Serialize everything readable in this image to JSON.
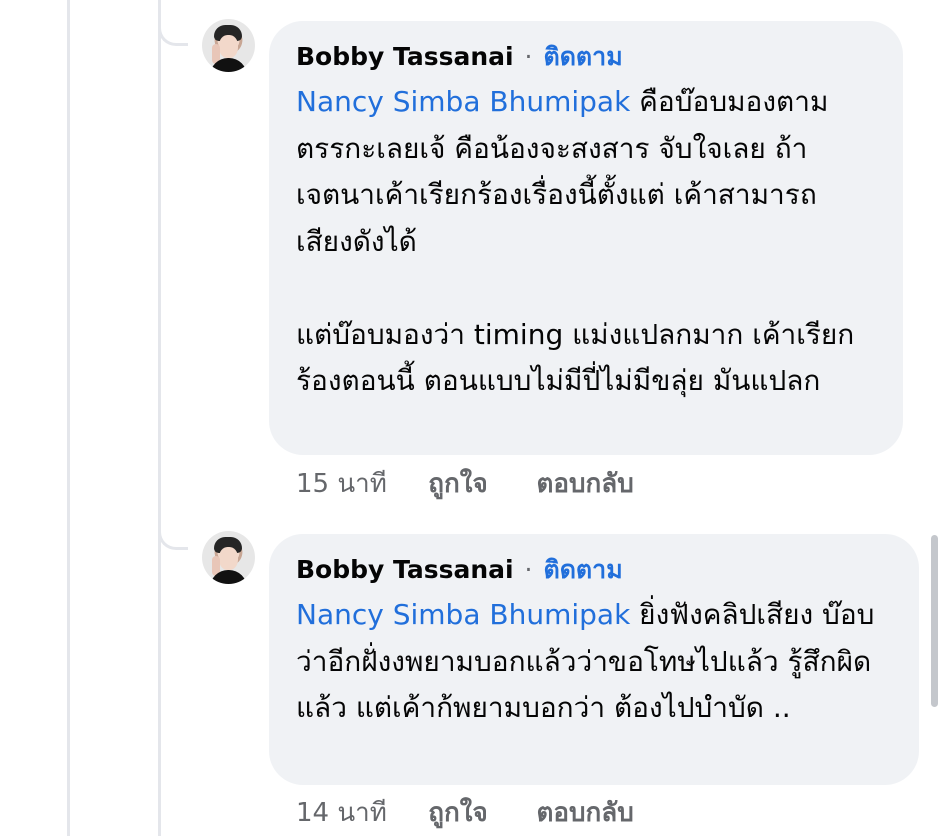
{
  "comments": [
    {
      "author": "Bobby Tassanai",
      "separator": "·",
      "follow_label": "ติดตาม",
      "mention": "Nancy Simba Bhumipak",
      "text": " คือบ๊อบมองตามตรรกะเลยเจ้ คือน้องจะสงสาร จับใจเลย ถ้าเจตนาเค้าเรียกร้องเรื่องนี้ตั้งแต่ เค้าสามารถเสียงดังได้\n\nแต่บ๊อบมองว่า timing แม่งแปลกมาก เค้าเรียกร้องตอนนี้ ตอนแบบไม่มีปี่ไม่มีขลุ่ย มันแปลก",
      "time": "15 นาที",
      "like_label": "ถูกใจ",
      "reply_label": "ตอบกลับ"
    },
    {
      "author": "Bobby Tassanai",
      "separator": "·",
      "follow_label": "ติดตาม",
      "mention": "Nancy Simba Bhumipak",
      "text": " ยิ่งฟังคลิปเสียง บ๊อบว่าอีกฝั่งงพยามบอกแล้วว่าขอโทษไปแล้ว รู้สึกผิดแล้ว แต่เค้าก้พยามบอกว่า ต้องไปบำบัด ..",
      "time": "14 นาที",
      "like_label": "ถูกใจ",
      "reply_label": "ตอบกลับ"
    }
  ],
  "colors": {
    "link": "#216fdb",
    "bubble": "#f0f2f5",
    "meta": "#65676b",
    "thread_line": "#e4e6eb"
  },
  "icons": {
    "avatar": "profile-photo-avatar"
  }
}
